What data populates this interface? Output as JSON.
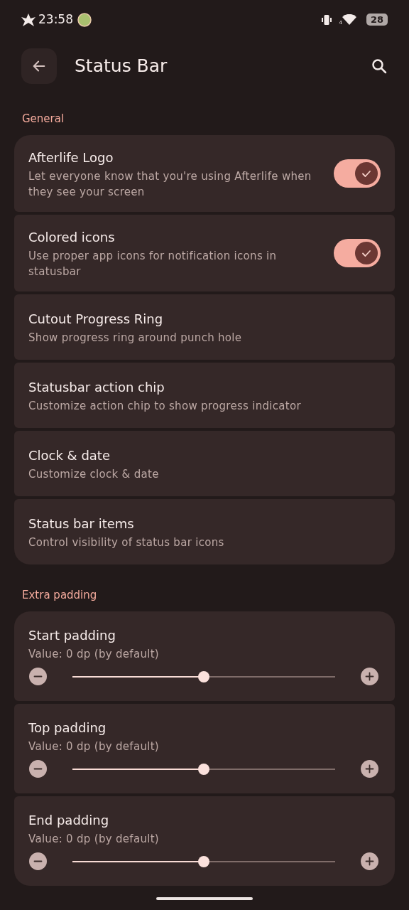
{
  "status_bar": {
    "time": "23:58",
    "wifi_label": "4",
    "battery": "28"
  },
  "header": {
    "title": "Status Bar"
  },
  "sections": [
    {
      "title": "General",
      "items": [
        {
          "kind": "switch",
          "title": "Afterlife Logo",
          "subtitle": "Let everyone know that you're using Afterlife when they see your screen",
          "on": true
        },
        {
          "kind": "switch",
          "title": "Colored icons",
          "subtitle": "Use proper app icons for notification icons in statusbar",
          "on": true
        },
        {
          "kind": "link",
          "title": "Cutout Progress Ring",
          "subtitle": "Show progress ring around punch hole"
        },
        {
          "kind": "link",
          "title": "Statusbar action chip",
          "subtitle": "Customize action chip to show progress indicator"
        },
        {
          "kind": "link",
          "title": "Clock & date",
          "subtitle": "Customize clock & date"
        },
        {
          "kind": "link",
          "title": "Status bar items",
          "subtitle": "Control visibility of status bar icons"
        }
      ]
    },
    {
      "title": "Extra padding",
      "items": [
        {
          "kind": "slider",
          "title": "Start padding",
          "subtitle": "Value: 0 dp (by default)",
          "level": 0.5
        },
        {
          "kind": "slider",
          "title": "Top padding",
          "subtitle": "Value: 0 dp (by default)",
          "level": 0.5
        },
        {
          "kind": "slider",
          "title": "End padding",
          "subtitle": "Value: 0 dp (by default)",
          "level": 0.5
        }
      ]
    }
  ]
}
